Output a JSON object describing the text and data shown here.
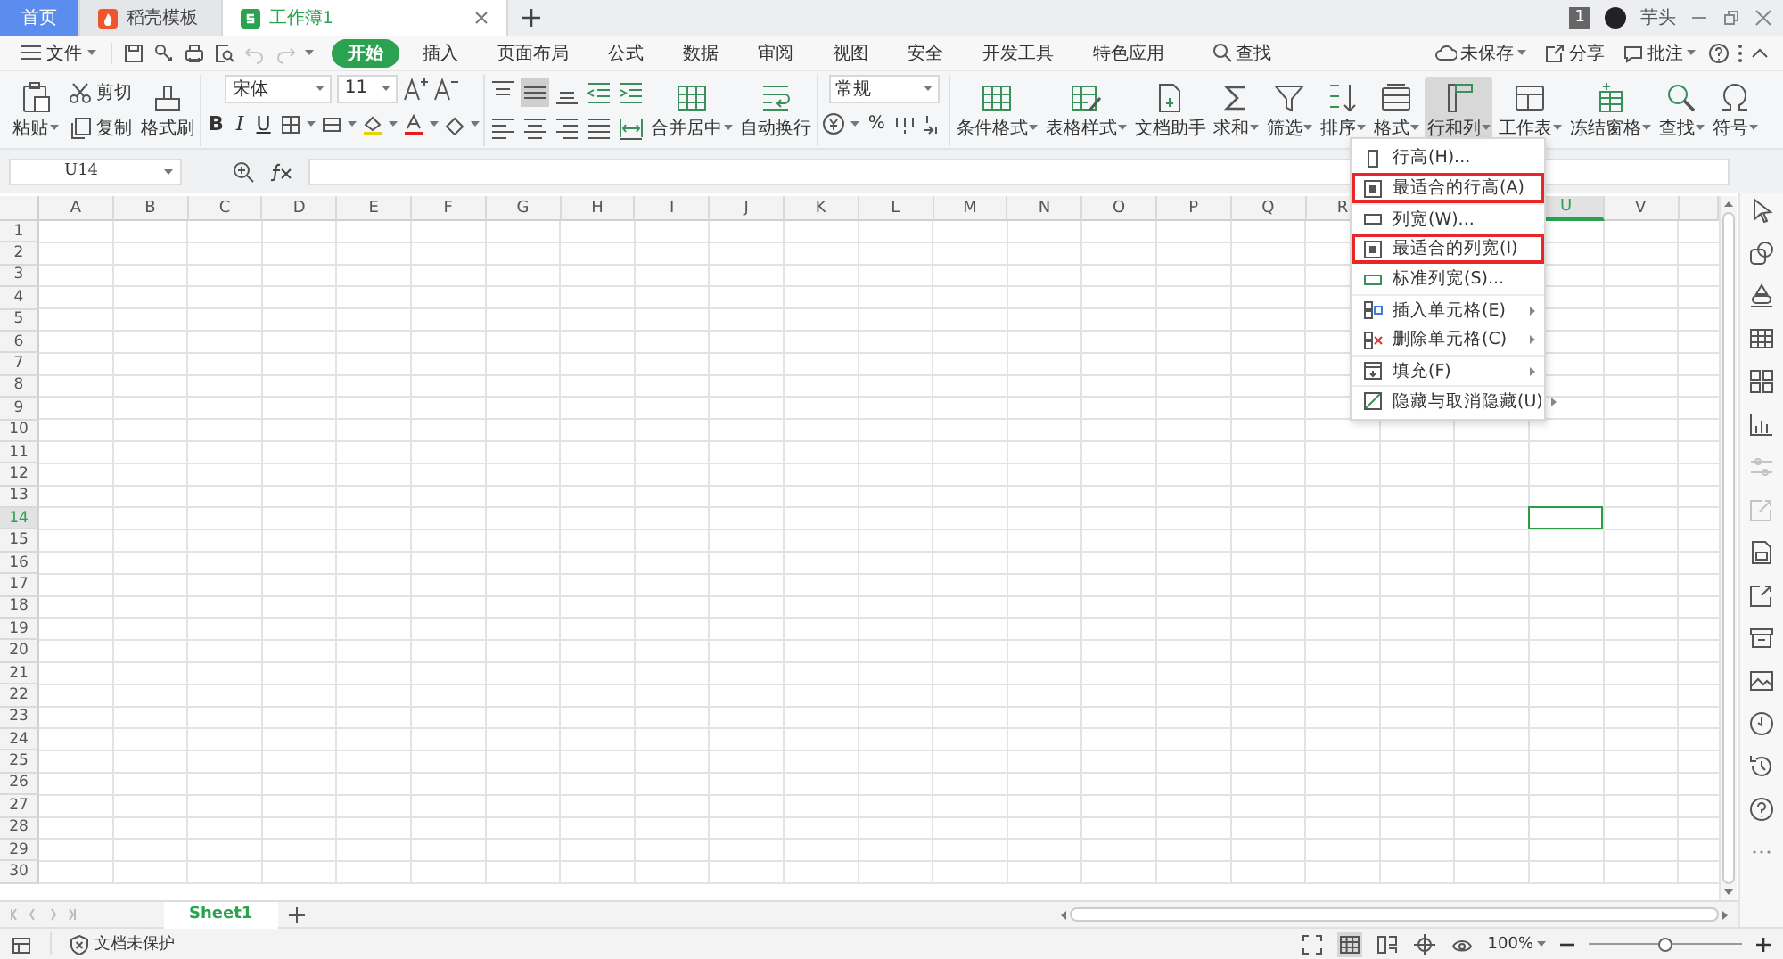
{
  "app_tabs": [
    {
      "kind": "home",
      "label": "首页",
      "selected": false
    },
    {
      "kind": "docer",
      "label": "稻壳模板",
      "selected": false
    },
    {
      "kind": "sheet",
      "label": "工作簿1",
      "selected": true
    }
  ],
  "account": {
    "badge": "1",
    "user": "芋头"
  },
  "menu_bar": {
    "file": "文件",
    "quick_access": [
      {
        "kind": "save",
        "disabled": false
      },
      {
        "kind": "link",
        "disabled": false
      },
      {
        "kind": "print",
        "disabled": false
      },
      {
        "kind": "preview",
        "disabled": false
      },
      {
        "kind": "undo",
        "disabled": true
      },
      {
        "kind": "redo",
        "disabled": true
      }
    ],
    "tabs": [
      {
        "label": "开始",
        "selected": true
      },
      {
        "label": "插入",
        "selected": false
      },
      {
        "label": "页面布局",
        "selected": false
      },
      {
        "label": "公式",
        "selected": false
      },
      {
        "label": "数据",
        "selected": false
      },
      {
        "label": "审阅",
        "selected": false
      },
      {
        "label": "视图",
        "selected": false
      },
      {
        "label": "安全",
        "selected": false
      },
      {
        "label": "开发工具",
        "selected": false
      },
      {
        "label": "特色应用",
        "selected": false
      }
    ],
    "search": "查找",
    "actions": [
      {
        "kind": "cloud",
        "label": "未保存",
        "dropdown": true
      },
      {
        "kind": "share",
        "label": "分享",
        "dropdown": false
      },
      {
        "kind": "comment",
        "label": "批注",
        "dropdown": true
      }
    ]
  },
  "ribbon": {
    "clipboard": [
      {
        "kind": "paste",
        "label": "粘贴",
        "dropdown": true
      },
      {
        "kind": "cut",
        "label": "剪切",
        "dropdown": false
      },
      {
        "kind": "copy",
        "label": "复制",
        "dropdown": false
      },
      {
        "kind": "painter",
        "label": "格式刷",
        "dropdown": false
      }
    ],
    "font": {
      "family": "宋体",
      "size": "11",
      "styles": [
        "B",
        "I",
        "U"
      ]
    },
    "align": [
      {
        "kind": "top",
        "selected": false
      },
      {
        "kind": "middle",
        "selected": true
      },
      {
        "kind": "bottom",
        "selected": false
      },
      {
        "kind": "indent-less",
        "selected": false
      },
      {
        "kind": "indent-more",
        "selected": false
      },
      {
        "kind": "left",
        "selected": false
      },
      {
        "kind": "center",
        "selected": false
      },
      {
        "kind": "right",
        "selected": false
      },
      {
        "kind": "justify",
        "selected": false
      },
      {
        "kind": "distribute",
        "selected": false
      }
    ],
    "merge": "合并居中",
    "wrap": "自动换行",
    "number_format": "常规",
    "percent": "%",
    "tools": [
      {
        "kind": "cond",
        "label": "条件格式",
        "dropdown": true,
        "selected": false
      },
      {
        "kind": "tstyle",
        "label": "表格样式",
        "dropdown": true,
        "selected": false
      },
      {
        "kind": "helper",
        "label": "文档助手",
        "dropdown": false,
        "selected": false
      },
      {
        "kind": "sum",
        "label": "求和",
        "dropdown": true,
        "selected": false
      },
      {
        "kind": "filter",
        "label": "筛选",
        "dropdown": true,
        "selected": false
      },
      {
        "kind": "sort",
        "label": "排序",
        "dropdown": true,
        "selected": false
      },
      {
        "kind": "format",
        "label": "格式",
        "dropdown": true,
        "selected": false
      },
      {
        "kind": "rowcol",
        "label": "行和列",
        "dropdown": true,
        "selected": true
      },
      {
        "kind": "sheet",
        "label": "工作表",
        "dropdown": true,
        "selected": false
      },
      {
        "kind": "freeze",
        "label": "冻结窗格",
        "dropdown": true,
        "selected": false
      },
      {
        "kind": "find",
        "label": "查找",
        "dropdown": true,
        "selected": false
      },
      {
        "kind": "symbol",
        "label": "符号",
        "dropdown": true,
        "selected": false
      }
    ]
  },
  "formula_bar": {
    "cell": "U14"
  },
  "grid": {
    "columns": [
      {
        "label": "A",
        "selected": false
      },
      {
        "label": "B",
        "selected": false
      },
      {
        "label": "C",
        "selected": false
      },
      {
        "label": "D",
        "selected": false
      },
      {
        "label": "E",
        "selected": false
      },
      {
        "label": "F",
        "selected": false
      },
      {
        "label": "G",
        "selected": false
      },
      {
        "label": "H",
        "selected": false
      },
      {
        "label": "I",
        "selected": false
      },
      {
        "label": "J",
        "selected": false
      },
      {
        "label": "K",
        "selected": false
      },
      {
        "label": "L",
        "selected": false
      },
      {
        "label": "M",
        "selected": false
      },
      {
        "label": "N",
        "selected": false
      },
      {
        "label": "O",
        "selected": false
      },
      {
        "label": "P",
        "selected": false
      },
      {
        "label": "Q",
        "selected": false
      },
      {
        "label": "R",
        "selected": false
      },
      null,
      null,
      {
        "label": "U",
        "selected": true
      },
      {
        "label": "V",
        "selected": false
      }
    ],
    "rows": [
      {
        "label": "1",
        "selected": false
      },
      {
        "label": "2",
        "selected": false
      },
      {
        "label": "3",
        "selected": false
      },
      {
        "label": "4",
        "selected": false
      },
      {
        "label": "5",
        "selected": false
      },
      {
        "label": "6",
        "selected": false
      },
      {
        "label": "7",
        "selected": false
      },
      {
        "label": "8",
        "selected": false
      },
      {
        "label": "9",
        "selected": false
      },
      {
        "label": "10",
        "selected": false
      },
      {
        "label": "11",
        "selected": false
      },
      {
        "label": "12",
        "selected": false
      },
      {
        "label": "13",
        "selected": false
      },
      {
        "label": "14",
        "selected": true
      },
      {
        "label": "15",
        "selected": false
      },
      {
        "label": "16",
        "selected": false
      },
      {
        "label": "17",
        "selected": false
      },
      {
        "label": "18",
        "selected": false
      },
      {
        "label": "19",
        "selected": false
      },
      {
        "label": "20",
        "selected": false
      },
      {
        "label": "21",
        "selected": false
      },
      {
        "label": "22",
        "selected": false
      },
      {
        "label": "23",
        "selected": false
      },
      {
        "label": "24",
        "selected": false
      },
      {
        "label": "25",
        "selected": false
      },
      {
        "label": "26",
        "selected": false
      },
      {
        "label": "27",
        "selected": false
      },
      {
        "label": "28",
        "selected": false
      },
      {
        "label": "29",
        "selected": false
      },
      {
        "label": "30",
        "selected": false
      }
    ]
  },
  "row_col_menu": [
    {
      "kind": "row-height",
      "label": "行高(H)...",
      "annotated": false,
      "submenu": false,
      "divider_before": false
    },
    {
      "kind": "fit-row",
      "label": "最适合的行高(A)",
      "annotated": true,
      "submenu": false,
      "divider_before": false
    },
    {
      "kind": "col-width",
      "label": "列宽(W)...",
      "annotated": false,
      "submenu": false,
      "divider_before": true
    },
    {
      "kind": "fit-col",
      "label": "最适合的列宽(I)",
      "annotated": true,
      "submenu": false,
      "divider_before": false
    },
    {
      "kind": "std-width",
      "label": "标准列宽(S)...",
      "annotated": false,
      "submenu": false,
      "divider_before": false
    },
    {
      "kind": "insert",
      "label": "插入单元格(E)",
      "annotated": false,
      "submenu": true,
      "divider_before": true
    },
    {
      "kind": "delete",
      "label": "删除单元格(C)",
      "annotated": false,
      "submenu": true,
      "divider_before": false
    },
    {
      "kind": "fill",
      "label": "填充(F)",
      "annotated": false,
      "submenu": true,
      "divider_before": true
    },
    {
      "kind": "hide",
      "label": "隐藏与取消隐藏(U)",
      "annotated": false,
      "submenu": true,
      "divider_before": true
    }
  ],
  "sheets": [
    {
      "label": "Sheet1",
      "selected": true
    }
  ],
  "side_tools": [
    {
      "kind": "cursor",
      "disabled": false
    },
    {
      "kind": "shapes",
      "disabled": false
    },
    {
      "kind": "stamp",
      "disabled": false
    },
    {
      "kind": "table",
      "disabled": false
    },
    {
      "kind": "apps",
      "disabled": false
    },
    {
      "kind": "chart",
      "disabled": false
    },
    {
      "kind": "sliders",
      "disabled": true
    },
    {
      "kind": "export",
      "disabled": true
    },
    {
      "kind": "docimage",
      "disabled": false
    },
    {
      "kind": "share",
      "disabled": false
    },
    {
      "kind": "archive",
      "disabled": false
    },
    {
      "kind": "image",
      "disabled": false
    },
    {
      "kind": "backup",
      "disabled": false
    },
    {
      "kind": "history",
      "disabled": false
    },
    {
      "kind": "help",
      "disabled": false
    },
    {
      "kind": "more",
      "disabled": false
    }
  ],
  "status_bar": {
    "protection": "文档未保护",
    "views": [
      {
        "kind": "fullscreen",
        "selected": false
      },
      {
        "kind": "normal",
        "selected": true
      },
      {
        "kind": "pagebreak",
        "selected": false
      },
      {
        "kind": "reading",
        "selected": false
      },
      {
        "kind": "eye",
        "selected": false
      }
    ],
    "zoom": "100%",
    "zoom_slider": {
      "level": 0.5
    }
  }
}
